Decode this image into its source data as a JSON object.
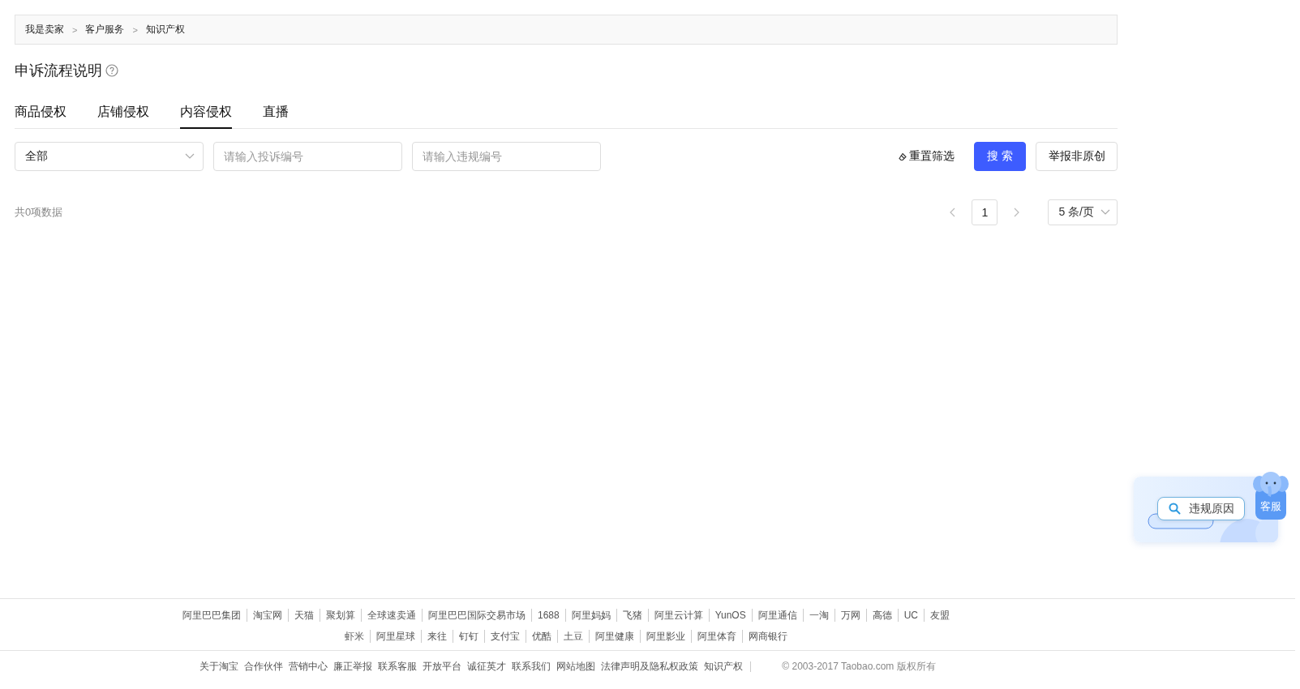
{
  "breadcrumb": {
    "items": [
      "我是卖家",
      "客户服务",
      "知识产权"
    ],
    "separators": [
      ">",
      ">"
    ]
  },
  "title": "申诉流程说明",
  "tabs": [
    {
      "label": "商品侵权",
      "selected": false
    },
    {
      "label": "店铺侵权",
      "selected": false
    },
    {
      "label": "内容侵权",
      "selected": true
    },
    {
      "label": "直播",
      "selected": false
    }
  ],
  "filters": {
    "select": {
      "value": "全部"
    },
    "inputs": [
      {
        "placeholder": "请输入投诉编号"
      },
      {
        "placeholder": "请输入违规编号"
      }
    ],
    "reset": "重置筛选",
    "buttons": [
      {
        "label": "搜 索",
        "kind": "primary"
      },
      {
        "label": "举报非原创",
        "kind": "default"
      }
    ]
  },
  "summary": "共0项数据",
  "pager": {
    "prev": {
      "disabled": true
    },
    "pages": [
      {
        "label": "1",
        "selected": true
      }
    ],
    "next": {
      "disabled": true
    },
    "page_size": "5 条/页"
  },
  "floating": {
    "search_pill": "违规原因",
    "service_button": "客服"
  },
  "footer": {
    "links_row_1": [
      "阿里巴巴集团",
      "淘宝网",
      "天猫",
      "聚划算",
      "全球速卖通",
      "阿里巴巴国际交易市场",
      "1688",
      "阿里妈妈",
      "飞猪",
      "阿里云计算",
      "YunOS",
      "阿里通信",
      "一淘",
      "万网",
      "高德",
      "UC",
      "友盟"
    ],
    "links_row_2": [
      "虾米",
      "阿里星球",
      "来往",
      "钉钉",
      "支付宝",
      "优酷",
      "土豆",
      "阿里健康",
      "阿里影业",
      "阿里体育",
      "网商银行"
    ],
    "bottom_links": [
      "关于淘宝",
      "合作伙伴",
      "营销中心",
      "廉正举报",
      "联系客服",
      "开放平台",
      "诚征英才",
      "联系我们",
      "网站地图",
      "法律声明及隐私权政策",
      "知识产权"
    ],
    "copyright": "© 2003-2017 Taobao.com 版权所有"
  }
}
